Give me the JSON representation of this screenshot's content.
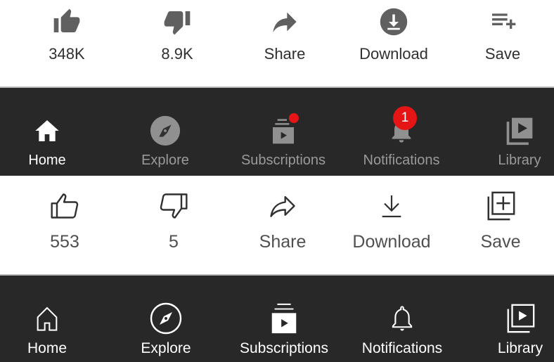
{
  "actions_filled": [
    {
      "label": "348K",
      "icon": "thumbs-up-icon"
    },
    {
      "label": "8.9K",
      "icon": "thumbs-down-icon"
    },
    {
      "label": "Share",
      "icon": "share-icon"
    },
    {
      "label": "Download",
      "icon": "download-icon"
    },
    {
      "label": "Save",
      "icon": "playlist-add-icon"
    }
  ],
  "nav_filled": [
    {
      "label": "Home",
      "icon": "home-icon",
      "active": true
    },
    {
      "label": "Explore",
      "icon": "compass-icon"
    },
    {
      "label": "Subscriptions",
      "icon": "subscriptions-icon",
      "dot": true
    },
    {
      "label": "Notifications",
      "icon": "bell-icon",
      "badge": "1"
    },
    {
      "label": "Library",
      "icon": "library-icon"
    }
  ],
  "actions_outline": [
    {
      "label": "553",
      "icon": "thumbs-up-icon"
    },
    {
      "label": "5",
      "icon": "thumbs-down-icon"
    },
    {
      "label": "Share",
      "icon": "share-icon"
    },
    {
      "label": "Download",
      "icon": "download-icon"
    },
    {
      "label": "Save",
      "icon": "library-add-icon"
    }
  ],
  "nav_outline": [
    {
      "label": "Home",
      "icon": "home-icon"
    },
    {
      "label": "Explore",
      "icon": "compass-icon"
    },
    {
      "label": "Subscriptions",
      "icon": "subscriptions-icon"
    },
    {
      "label": "Notifications",
      "icon": "bell-icon"
    },
    {
      "label": "Library",
      "icon": "library-icon"
    }
  ],
  "colors": {
    "dark_bg": "#282828",
    "badge": "#e51515",
    "inactive": "#9a9a9a",
    "icon_filled": "#606060"
  }
}
